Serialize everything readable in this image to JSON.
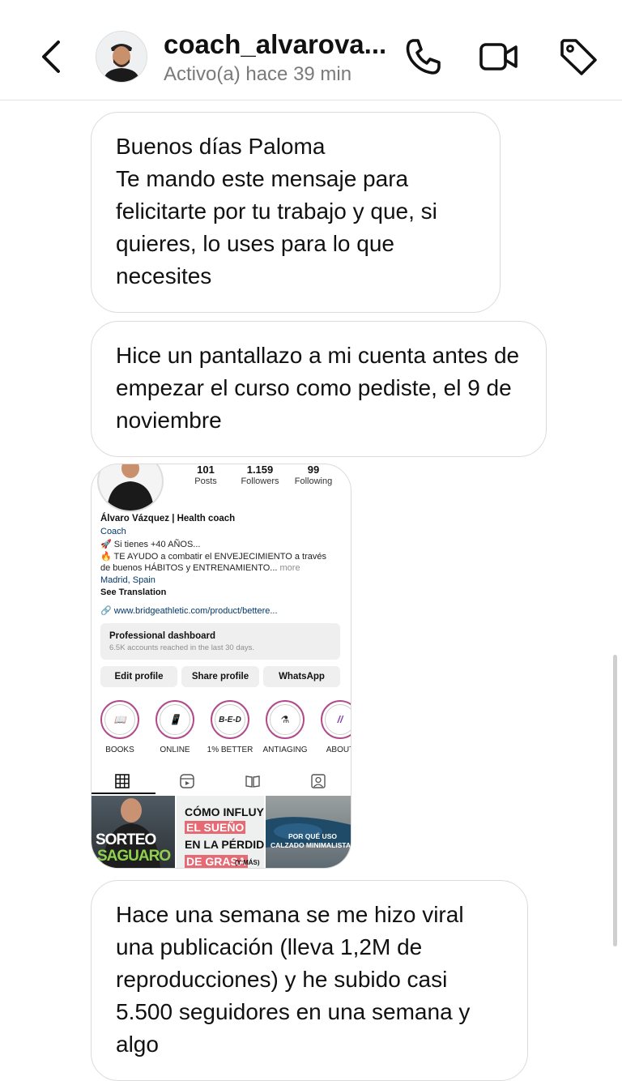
{
  "header": {
    "username": "coach_alvarova...",
    "status": "Activo(a) hace 39 min",
    "icons": [
      "back-chevron-icon",
      "phone-icon",
      "video-camera-icon",
      "tag-icon"
    ]
  },
  "messages": [
    {
      "lines": [
        "Buenos días Paloma",
        "Te mando este mensaje para felicitarte por tu trabajo y que, si quieres, lo uses para lo que necesites"
      ]
    },
    {
      "lines": [
        "Hice un pantallazo a mi cuenta antes de empezar el curso como pediste, el 9 de noviembre"
      ]
    },
    {
      "lines": [
        "Hace una semana se me hizo viral una publicación (lleva 1,2M de reproducciones) y he subido casi 5.500 seguidores en una semana y algo"
      ]
    }
  ],
  "profile_screenshot": {
    "stats": [
      {
        "value": "101",
        "label": "Posts"
      },
      {
        "value": "1.159",
        "label": "Followers"
      },
      {
        "value": "99",
        "label": "Following"
      }
    ],
    "name": "Álvaro Vázquez | Health coach",
    "category": "Coach",
    "bio_line1": "🚀 Si tienes +40 AÑOS...",
    "bio_line2": "🔥 TE AYUDO a combatir el ENVEJECIMIENTO a través",
    "bio_line3": "de buenos HÁBITOS y ENTRENAMIENTO...",
    "more": "more",
    "location": "Madrid, Spain",
    "see_translation": "See Translation",
    "link": "www.bridgeathletic.com/product/bettere...",
    "dashboard_title": "Professional dashboard",
    "dashboard_sub": "6.5K accounts reached in the last 30 days.",
    "buttons": [
      "Edit profile",
      "Share profile",
      "WhatsApp"
    ],
    "highlights": [
      {
        "label": "BOOKS",
        "glyph": "📖"
      },
      {
        "label": "ONLINE",
        "glyph": "📱"
      },
      {
        "label": "1% BETTER",
        "glyph": "B-E-D"
      },
      {
        "label": "ANTIAGING",
        "glyph": "⚗"
      },
      {
        "label": "ABOUT",
        "glyph": "//"
      }
    ],
    "tab_icons": [
      "grid-icon",
      "reels-icon",
      "guide-icon",
      "tagged-icon"
    ],
    "thumbs": [
      {
        "line1": "SORTEO",
        "line2": "SAGUARO"
      },
      {
        "line1": "CÓMO INFLUYE",
        "line2": "EL SUEÑO",
        "line3": "EN LA PÉRDIDA",
        "line4": "DE GRASA",
        "line5": "(Y MÁS)"
      },
      {
        "line1": "POR QUÉ USO",
        "line2": "CALZADO MINIMALISTA"
      }
    ]
  },
  "colors": {
    "bubble_border": "#dbdbdb",
    "status_gray": "#7a7a7a",
    "link_blue": "#00376b",
    "highlight_ring": "#b04a8a"
  }
}
